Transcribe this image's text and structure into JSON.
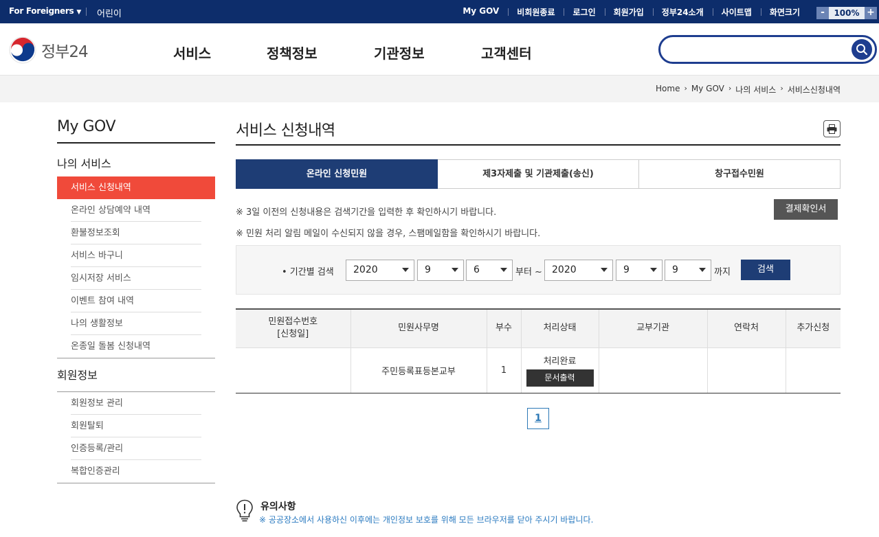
{
  "topbar": {
    "lang": "For Foreigners",
    "kids": "어린이",
    "links": [
      "My GOV",
      "비회원종료",
      "로그인",
      "회원가입",
      "정부24소개",
      "사이트맵",
      "화면크기"
    ],
    "zoom_minus": "-",
    "zoom_value": "100%",
    "zoom_plus": "+"
  },
  "header": {
    "logo_text": "정부24",
    "nav": [
      "서비스",
      "정책정보",
      "기관정보",
      "고객센터"
    ],
    "search_placeholder": ""
  },
  "breadcrumb": [
    "Home",
    "My GOV",
    "나의 서비스",
    "서비스신청내역"
  ],
  "sidebar": {
    "title": "My GOV",
    "group1": "나의 서비스",
    "items1": [
      "서비스 신청내역",
      "온라인 상담예약 내역",
      "환불정보조회",
      "서비스 바구니",
      "임시저장 서비스",
      "이벤트 참여 내역",
      "나의 생활정보",
      "온종일 돌봄 신청내역"
    ],
    "group2": "회원정보",
    "items2": [
      "회원정보 관리",
      "회원탈퇴",
      "인증등록/관리",
      "복합인증관리"
    ]
  },
  "content": {
    "title": "서비스 신청내역",
    "tabs": [
      "온라인 신청민원",
      "제3자제출 및 기관제출(송신)",
      "창구접수민원"
    ],
    "note1": "※ 3일 이전의 신청내용은 검색기간을 입력한 후 확인하시기 바랍니다.",
    "note2": "※ 민원 처리 알림 메일이 수신되지 않을 경우, 스팸메일함을 확인하시기 바랍니다.",
    "pay_confirm": "결제확인서",
    "search": {
      "label": "• 기간별 검색",
      "from_year": "2020",
      "from_month": "9",
      "from_day": "6",
      "from_text": "부터 ~",
      "to_year": "2020",
      "to_month": "9",
      "to_day": "9",
      "to_text": "까지",
      "button": "검색"
    },
    "table": {
      "headers": [
        "민원접수번호",
        "[신청일]",
        "민원사무명",
        "부수",
        "처리상태",
        "교부기관",
        "연락처",
        "추가신청"
      ],
      "rows": [
        {
          "number": "",
          "name": "주민등록표등본교부",
          "copies": "1",
          "status": "처리완료",
          "doc_button": "문서출력",
          "agency": "",
          "contact": "",
          "extra": ""
        }
      ]
    },
    "page": "1"
  },
  "notice": {
    "title": "유의사항",
    "message": "※ 공공장소에서 사용하신 이후에는 개인정보 보호를 위해 모든 브라우저를 닫아 주시기 바랍니다."
  },
  "colors": {
    "topbar": "#0d2d6b",
    "accent": "#1e3d75",
    "active_menu": "#f04a3a"
  }
}
